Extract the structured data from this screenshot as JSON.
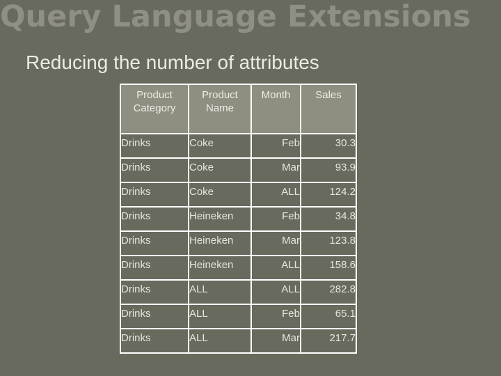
{
  "slide": {
    "title": "Query Language Extensions",
    "subtitle": "Reducing the number of attributes"
  },
  "colors": {
    "background": "#696a5e",
    "title": "#8f9083",
    "header_fill": "#8e8f81",
    "grid_lines": "#ffffff",
    "text": "#e6e6dc"
  },
  "table": {
    "headers": [
      [
        "Product",
        "Category"
      ],
      [
        "Product",
        "Name"
      ],
      [
        "Month"
      ],
      [
        "Sales"
      ]
    ],
    "rows": [
      [
        "Drinks",
        "Coke",
        "Feb",
        "30.3"
      ],
      [
        "Drinks",
        "Coke",
        "Mar",
        "93.9"
      ],
      [
        "Drinks",
        "Coke",
        "ALL",
        "124.2"
      ],
      [
        "Drinks",
        "Heineken",
        "Feb",
        "34.8"
      ],
      [
        "Drinks",
        "Heineken",
        "Mar",
        "123.8"
      ],
      [
        "Drinks",
        "Heineken",
        "ALL",
        "158.6"
      ],
      [
        "Drinks",
        "ALL",
        "ALL",
        "282.8"
      ],
      [
        "Drinks",
        "ALL",
        "Feb",
        "65.1"
      ],
      [
        "Drinks",
        "ALL",
        "Mar",
        "217.7"
      ]
    ]
  }
}
